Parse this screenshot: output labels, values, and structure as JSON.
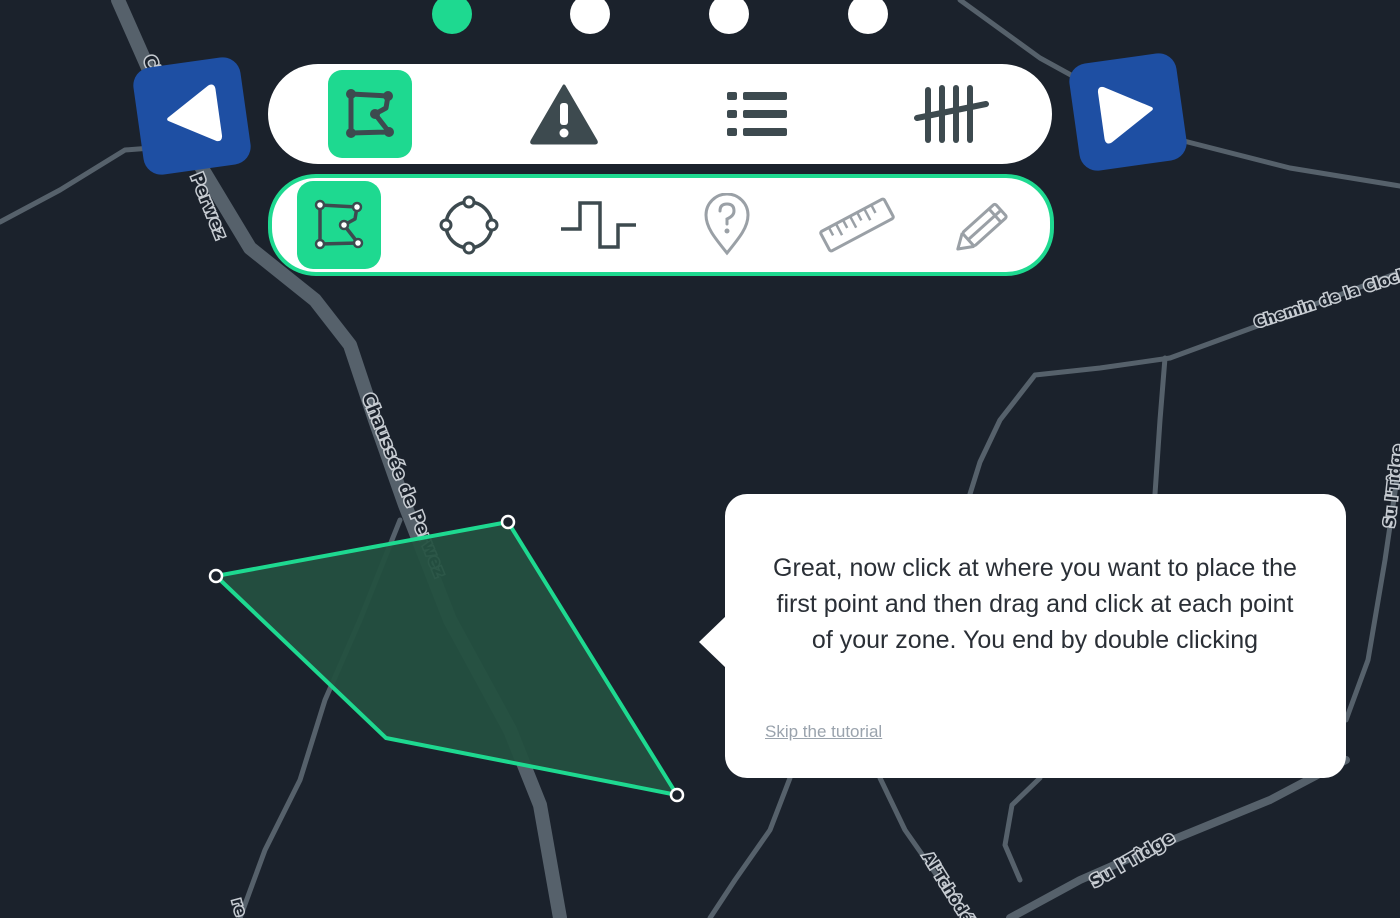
{
  "map": {
    "road_labels": [
      "Chaussée de Perwez",
      "Chaussée de Perwez",
      "Chemin de la Clocl",
      "Al'Tchôdé",
      "Su l'Tîdge",
      "Su l'Tîdge",
      "re"
    ],
    "colors": {
      "background": "#1b222c",
      "road": "#56616b",
      "zone_fill": "#245040",
      "zone_stroke": "#1ed990"
    }
  },
  "steps": {
    "total": 4,
    "active_index": 0
  },
  "navigation": {
    "prev_icon": "triangle-left-icon",
    "next_icon": "triangle-right-icon",
    "color": "#1e4fa3"
  },
  "categories": {
    "active_index": 0,
    "items": [
      {
        "icon": "polygon-zone-icon"
      },
      {
        "icon": "warning-icon"
      },
      {
        "icon": "list-icon"
      },
      {
        "icon": "tally-icon"
      }
    ]
  },
  "tools": {
    "active_index": 0,
    "items": [
      {
        "icon": "polygon-draw-icon"
      },
      {
        "icon": "circle-draw-icon"
      },
      {
        "icon": "line-draw-icon"
      },
      {
        "icon": "map-pin-question-icon"
      },
      {
        "icon": "ruler-icon"
      },
      {
        "icon": "pencil-icon"
      }
    ]
  },
  "tooltip": {
    "message": "Great, now click at where you want to place the first point and then drag and click at each point of your zone. You end by double clicking",
    "skip_label": "Skip the tutorial"
  },
  "accent_color": "#1ed990"
}
